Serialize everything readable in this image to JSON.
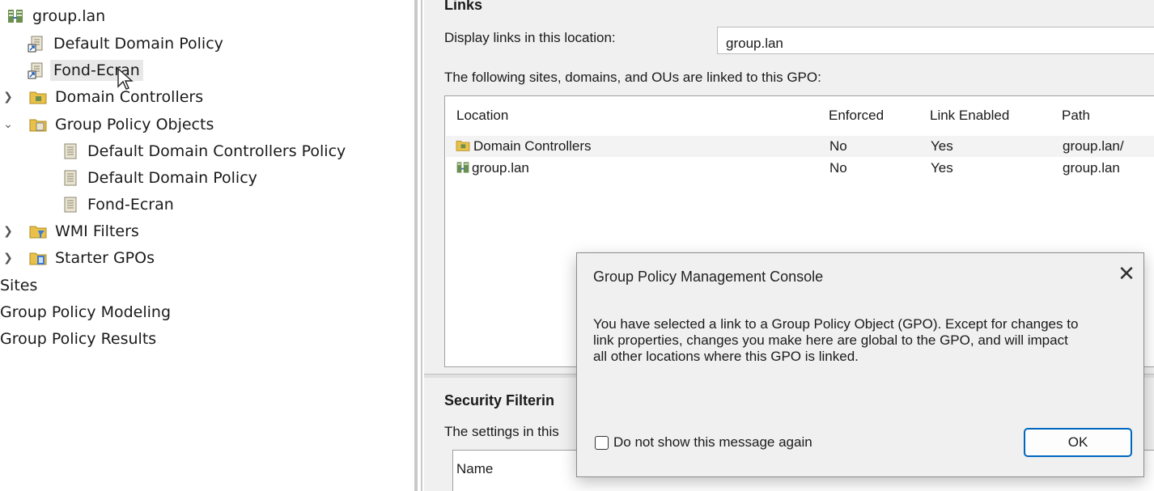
{
  "tree": {
    "domain_root": "group.lan",
    "linked_gpo_1": "Default Domain Policy",
    "linked_gpo_2": "Fond-Ecran",
    "domain_controllers": "Domain Controllers",
    "group_policy_objects": "Group Policy Objects",
    "gpo_1": "Default Domain Controllers Policy",
    "gpo_2": "Default Domain Policy",
    "gpo_3": "Fond-Ecran",
    "wmi_filters": "WMI Filters",
    "starter_gpos": "Starter GPOs",
    "sites": "Sites",
    "modeling": "Group Policy Modeling",
    "results": "Group Policy Results"
  },
  "links": {
    "section_title": "Links",
    "display_label": "Display links in this location:",
    "location_value": "group.lan",
    "description": "The following sites, domains, and OUs are linked to this GPO:",
    "columns": [
      "Location",
      "Enforced",
      "Link Enabled",
      "Path"
    ],
    "rows": [
      {
        "location": "Domain Controllers",
        "enforced": "No",
        "link_enabled": "Yes",
        "path": "group.lan/"
      },
      {
        "location": "group.lan",
        "enforced": "No",
        "link_enabled": "Yes",
        "path": "group.lan"
      }
    ]
  },
  "security": {
    "section_title": "Security Filterin",
    "description": "The settings in this",
    "column": "Name"
  },
  "dialog": {
    "title": "Group Policy Management Console",
    "message": "You have selected a link to a Group Policy Object (GPO). Except for changes to link properties, changes you make here are global to the GPO, and will impact all other locations where this GPO is linked.",
    "checkbox_label": "Do not show this message again",
    "ok_label": "OK"
  }
}
